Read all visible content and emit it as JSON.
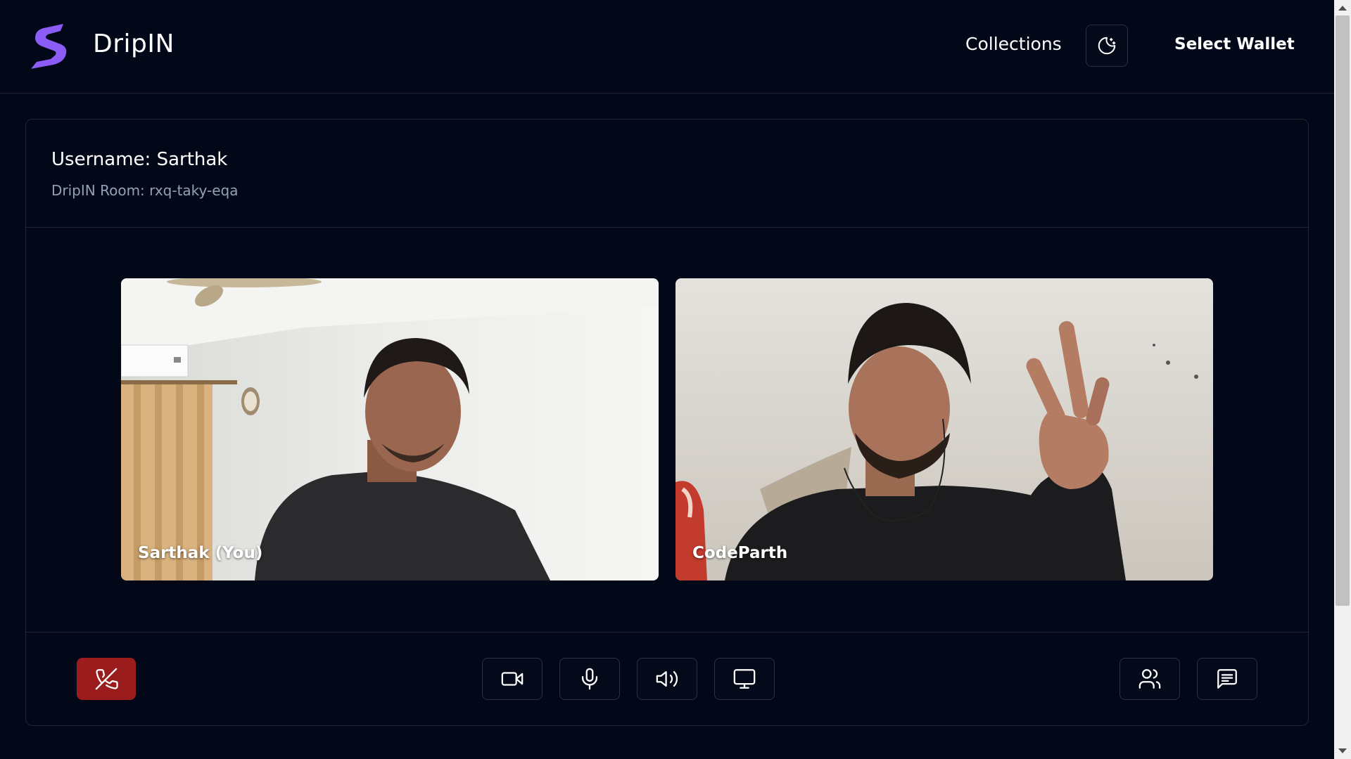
{
  "header": {
    "brand": "DripIN",
    "nav_collections": "Collections",
    "theme_toggle_icon": "moon-stars-icon",
    "select_wallet": "Select Wallet"
  },
  "room": {
    "username_line": "Username: Sarthak",
    "room_line": "DripIN Room: rxq-taky-eqa"
  },
  "participants": [
    {
      "name": "Sarthak (You)"
    },
    {
      "name": "CodeParth"
    }
  ],
  "controls": {
    "left": [
      {
        "icon": "phone-off-icon",
        "color": "#9b1c1c"
      }
    ],
    "center": [
      {
        "icon": "video-camera-icon"
      },
      {
        "icon": "microphone-icon"
      },
      {
        "icon": "speaker-icon"
      },
      {
        "icon": "monitor-screen-share-icon"
      }
    ],
    "right": [
      {
        "icon": "participants-icon"
      },
      {
        "icon": "chat-icon"
      }
    ]
  },
  "colors": {
    "background": "#030818",
    "accent": "#8b5cf6",
    "end_call": "#9b1c1c",
    "muted_text": "#94a0b8"
  }
}
